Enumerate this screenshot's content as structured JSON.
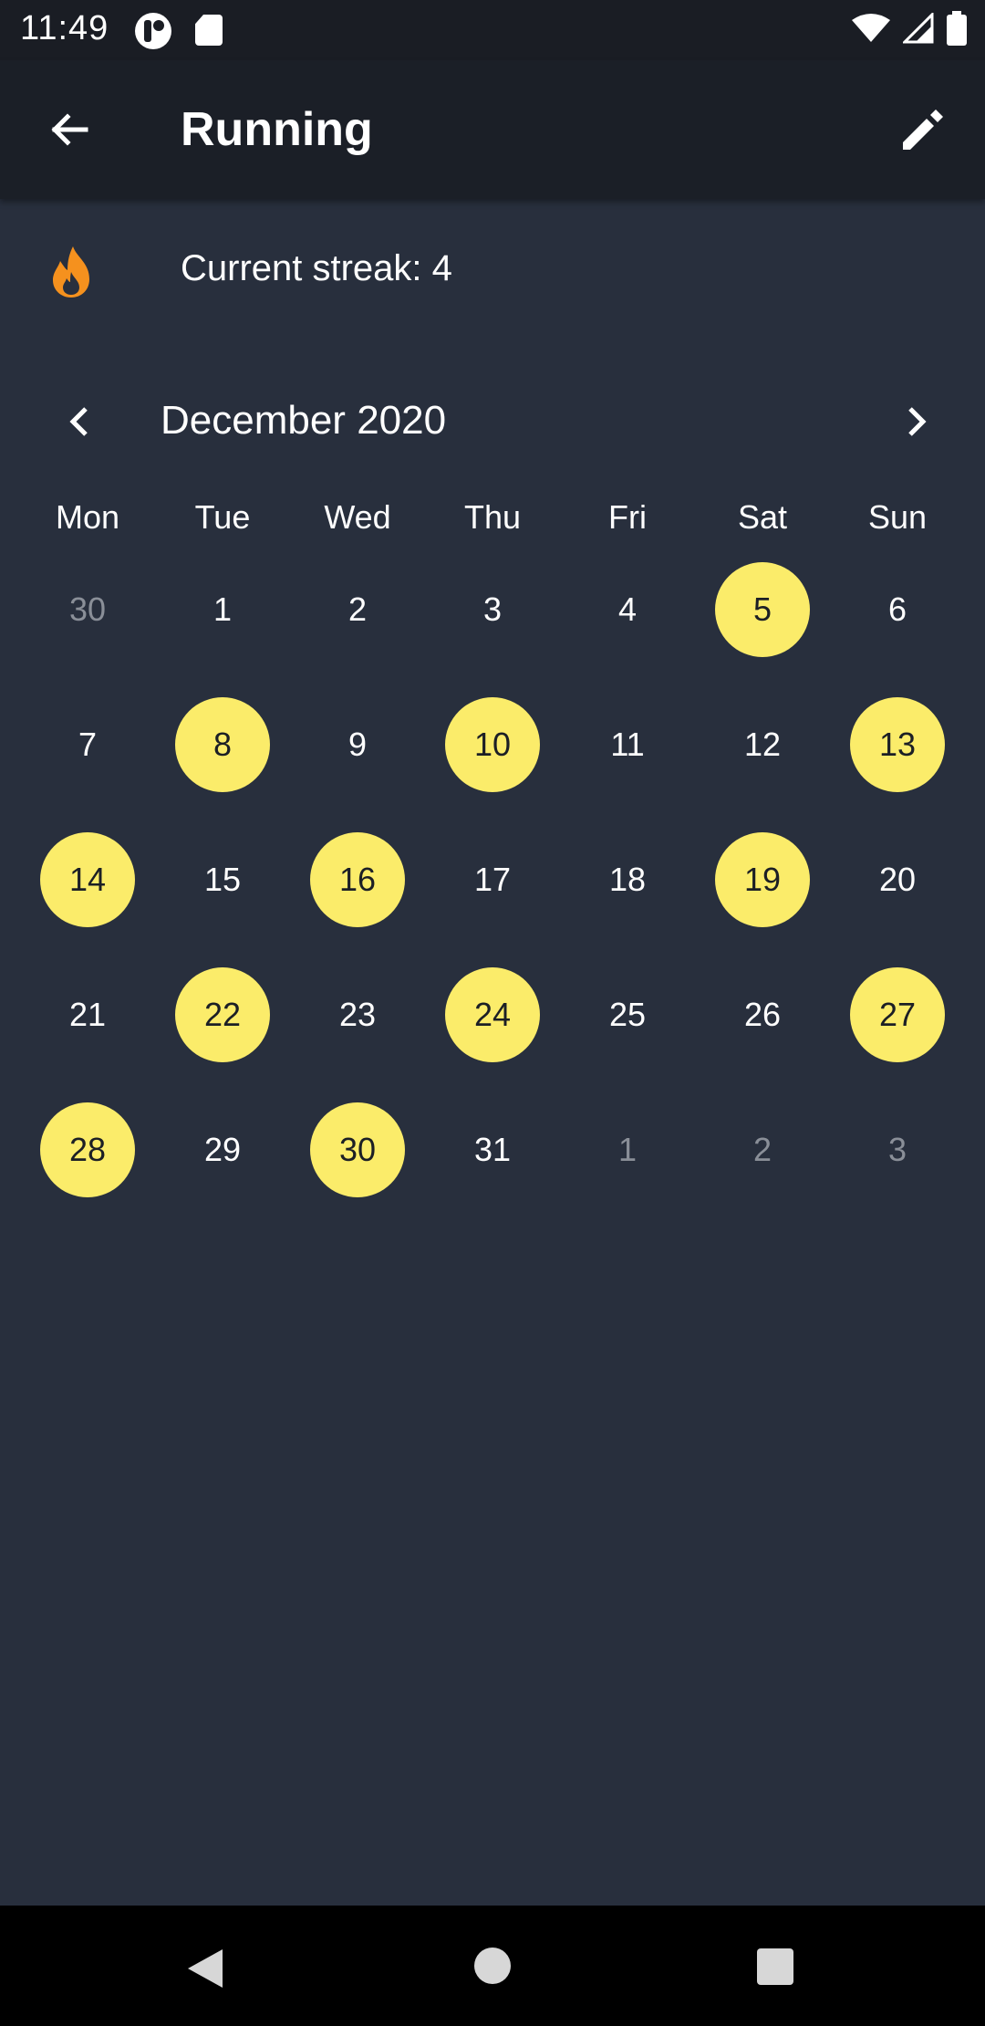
{
  "status_bar": {
    "time": "11:49",
    "icons": [
      "app-notification-icon",
      "sd-card-icon",
      "wifi-icon",
      "signal-icon",
      "battery-icon"
    ]
  },
  "app_bar": {
    "title": "Running",
    "back_icon": "arrow-back-icon",
    "edit_icon": "pencil-icon"
  },
  "streak": {
    "text": "Current streak: 4",
    "icon": "flame-icon",
    "icon_color": "#f5911e"
  },
  "calendar": {
    "month_label": "December 2020",
    "weekdays": [
      "Mon",
      "Tue",
      "Wed",
      "Thu",
      "Fri",
      "Sat",
      "Sun"
    ],
    "highlight_color": "#fbec6a",
    "weeks": [
      [
        {
          "n": "30",
          "muted": true
        },
        {
          "n": "1"
        },
        {
          "n": "2"
        },
        {
          "n": "3"
        },
        {
          "n": "4"
        },
        {
          "n": "5",
          "done": true
        },
        {
          "n": "6"
        }
      ],
      [
        {
          "n": "7"
        },
        {
          "n": "8",
          "done": true
        },
        {
          "n": "9"
        },
        {
          "n": "10",
          "done": true
        },
        {
          "n": "11"
        },
        {
          "n": "12"
        },
        {
          "n": "13",
          "done": true
        }
      ],
      [
        {
          "n": "14",
          "done": true
        },
        {
          "n": "15"
        },
        {
          "n": "16",
          "done": true
        },
        {
          "n": "17"
        },
        {
          "n": "18"
        },
        {
          "n": "19",
          "done": true
        },
        {
          "n": "20"
        }
      ],
      [
        {
          "n": "21"
        },
        {
          "n": "22",
          "done": true
        },
        {
          "n": "23"
        },
        {
          "n": "24",
          "done": true
        },
        {
          "n": "25"
        },
        {
          "n": "26"
        },
        {
          "n": "27",
          "done": true
        }
      ],
      [
        {
          "n": "28",
          "done": true
        },
        {
          "n": "29"
        },
        {
          "n": "30",
          "done": true
        },
        {
          "n": "31"
        },
        {
          "n": "1",
          "muted": true
        },
        {
          "n": "2",
          "muted": true
        },
        {
          "n": "3",
          "muted": true
        }
      ]
    ]
  },
  "nav_bar": {
    "icons": [
      "nav-back-icon",
      "nav-home-icon",
      "nav-recents-icon"
    ]
  }
}
